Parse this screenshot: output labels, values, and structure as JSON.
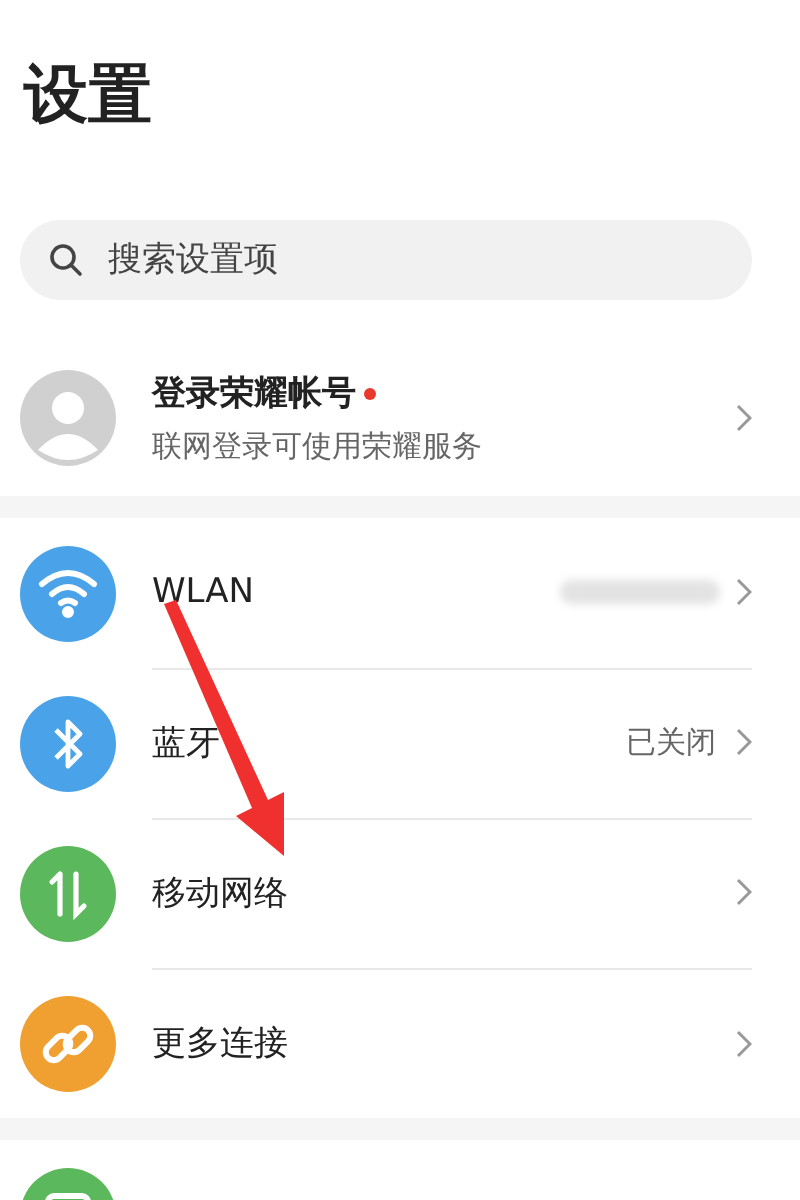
{
  "title": "设置",
  "search": {
    "placeholder": "搜索设置项"
  },
  "account": {
    "name": "登录荣耀帐号",
    "new_badge": true,
    "subtitle": "联网登录可使用荣耀服务"
  },
  "groups": [
    {
      "items": [
        {
          "kind": "wifi",
          "color": "#4aa3e8",
          "label": "WLAN",
          "value_hidden": true
        },
        {
          "kind": "bluetooth",
          "color": "#4aa3e8",
          "label": "蓝牙",
          "value": "已关闭"
        },
        {
          "kind": "mobile",
          "color": "#5cb85c",
          "label": "移动网络"
        },
        {
          "kind": "link",
          "color": "#f0a030",
          "label": "更多连接"
        }
      ]
    },
    {
      "items": [
        {
          "kind": "display",
          "color": "#5cb85c"
        }
      ]
    }
  ]
}
